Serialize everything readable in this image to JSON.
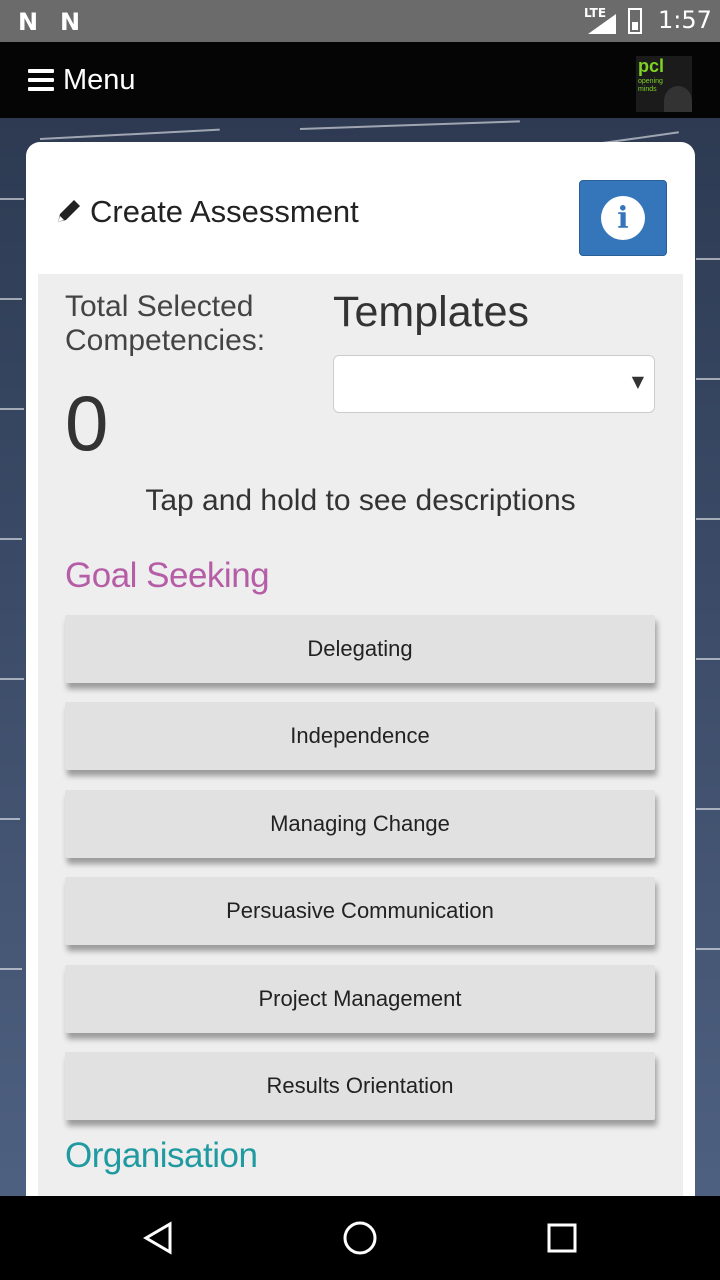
{
  "status_bar": {
    "notification_icons": [
      "N",
      "N"
    ],
    "network": "LTE",
    "time": "1:57"
  },
  "header": {
    "menu_label": "Menu",
    "logo": {
      "brand": "pcl",
      "tagline_line1": "opening",
      "tagline_line2": "minds"
    }
  },
  "card": {
    "title": "Create Assessment",
    "total_label": "Total Selected Competencies:",
    "total_count": "0",
    "templates_label": "Templates",
    "templates_selected": "",
    "select_arrow": "▼",
    "hint": "Tap and hold to see descriptions",
    "sections": [
      {
        "title": "Goal Seeking",
        "color": "#b55da6",
        "items": [
          "Delegating",
          "Independence",
          "Managing Change",
          "Persuasive Communication",
          "Project Management",
          "Results Orientation"
        ]
      },
      {
        "title": "Organisation",
        "color": "#1f9aa1",
        "items": []
      }
    ]
  },
  "colors": {
    "info_button": "#3476b9",
    "header_bg": "#050505",
    "status_bg": "#6b6b6b"
  },
  "icons": {
    "menu": "hamburger-icon",
    "edit": "pencil-icon",
    "info": "info-icon",
    "back": "back-triangle-icon",
    "home": "home-circle-icon",
    "recents": "recents-square-icon"
  }
}
